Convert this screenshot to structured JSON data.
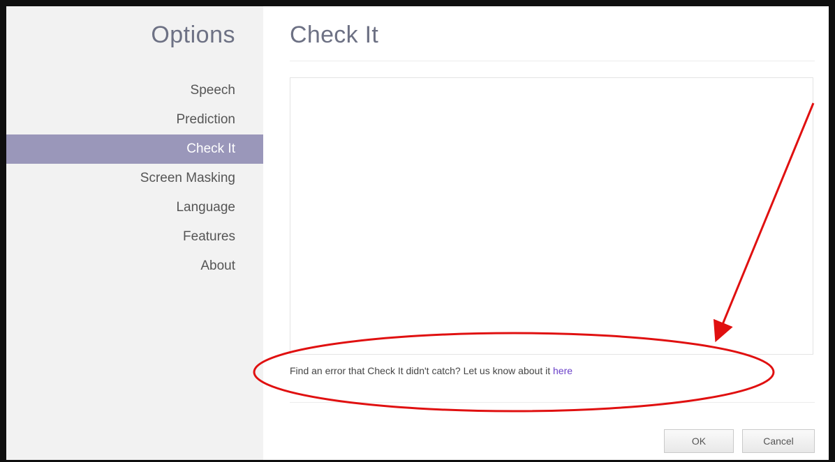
{
  "sidebar": {
    "title": "Options",
    "items": [
      {
        "label": "Speech"
      },
      {
        "label": "Prediction"
      },
      {
        "label": "Check It"
      },
      {
        "label": "Screen Masking"
      },
      {
        "label": "Language"
      },
      {
        "label": "Features"
      },
      {
        "label": "About"
      }
    ],
    "active_index": 2
  },
  "main": {
    "title": "Check It",
    "feedback_text": "Find an error that Check It didn't catch? Let us know about it ",
    "feedback_link": "here"
  },
  "footer": {
    "ok_label": "OK",
    "cancel_label": "Cancel"
  },
  "colors": {
    "active_item_bg": "#9a97ba",
    "title_color": "#6d7184",
    "link_color": "#6a40c8",
    "annotation_color": "#e01010"
  }
}
